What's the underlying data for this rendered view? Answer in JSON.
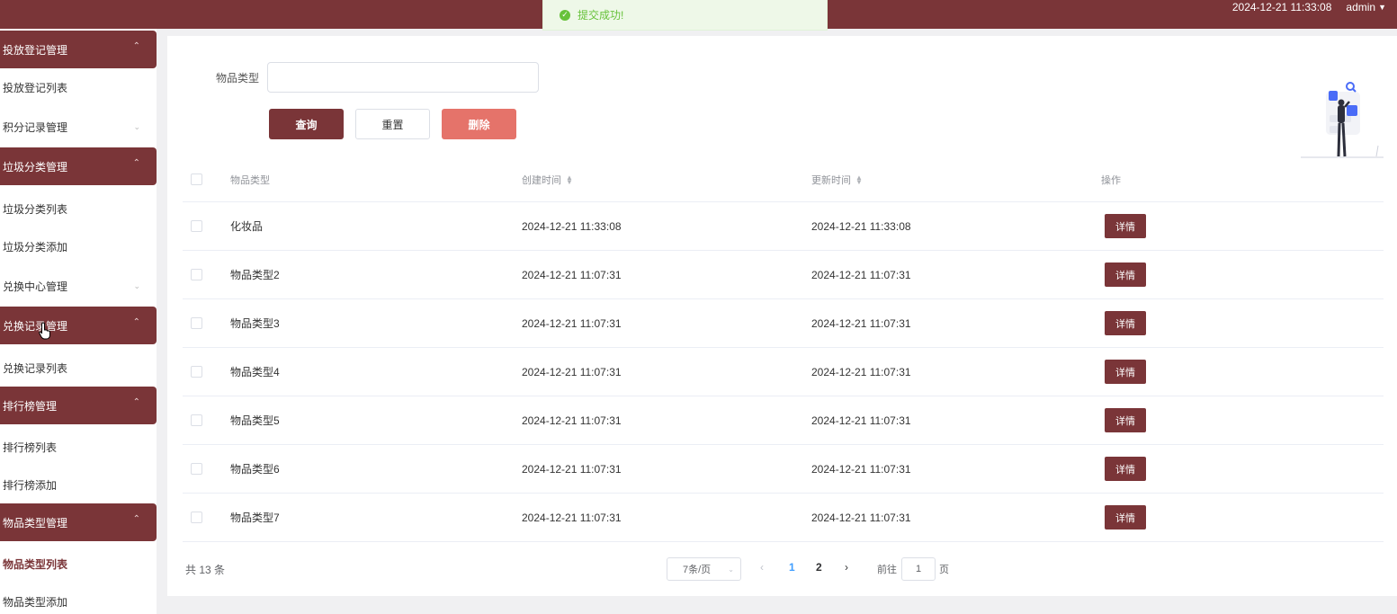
{
  "topbar": {
    "datetime": "2024-12-21 11:33:08",
    "user": "admin",
    "user_chevron": "chevron-down-icon"
  },
  "toast": {
    "text": "提交成功!",
    "icon": "check-circle-icon"
  },
  "sidebar": {
    "sections": [
      {
        "label": "投放登记管理",
        "expanded": true,
        "items": [
          "投放登记列表"
        ]
      },
      {
        "label": "积分记录管理",
        "expanded": false,
        "items": []
      },
      {
        "label": "垃圾分类管理",
        "expanded": true,
        "items": [
          "垃圾分类列表",
          "垃圾分类添加"
        ]
      },
      {
        "label": "兑换中心管理",
        "expanded": false,
        "items": []
      },
      {
        "label": "兑换记录管理",
        "expanded": true,
        "items": [
          "兑换记录列表"
        ]
      },
      {
        "label": "排行榜管理",
        "expanded": true,
        "items": [
          "排行榜列表",
          "排行榜添加"
        ]
      },
      {
        "label": "物品类型管理",
        "expanded": true,
        "items": [
          "物品类型列表",
          "物品类型添加"
        ]
      }
    ],
    "active_item": "物品类型列表"
  },
  "search": {
    "label": "物品类型",
    "value": "",
    "placeholder": ""
  },
  "buttons": {
    "query": "查询",
    "reset": "重置",
    "delete": "删除"
  },
  "table": {
    "headers": {
      "type": "物品类型",
      "created": "创建时间",
      "updated": "更新时间",
      "op": "操作"
    },
    "detail_label": "详情",
    "rows": [
      {
        "type": "化妆品",
        "created": "2024-12-21 11:33:08",
        "updated": "2024-12-21 11:33:08"
      },
      {
        "type": "物品类型2",
        "created": "2024-12-21 11:07:31",
        "updated": "2024-12-21 11:07:31"
      },
      {
        "type": "物品类型3",
        "created": "2024-12-21 11:07:31",
        "updated": "2024-12-21 11:07:31"
      },
      {
        "type": "物品类型4",
        "created": "2024-12-21 11:07:31",
        "updated": "2024-12-21 11:07:31"
      },
      {
        "type": "物品类型5",
        "created": "2024-12-21 11:07:31",
        "updated": "2024-12-21 11:07:31"
      },
      {
        "type": "物品类型6",
        "created": "2024-12-21 11:07:31",
        "updated": "2024-12-21 11:07:31"
      },
      {
        "type": "物品类型7",
        "created": "2024-12-21 11:07:31",
        "updated": "2024-12-21 11:07:31"
      }
    ]
  },
  "pagination": {
    "total": "共 13 条",
    "page_size": "7条/页",
    "pages": [
      "1",
      "2"
    ],
    "current_page": "1",
    "goto_prefix": "前往",
    "goto_value": "1",
    "goto_suffix": "页"
  },
  "colors": {
    "primary": "#7a3538",
    "danger": "#e5736a",
    "success": "#67c23a",
    "link": "#409eff"
  }
}
